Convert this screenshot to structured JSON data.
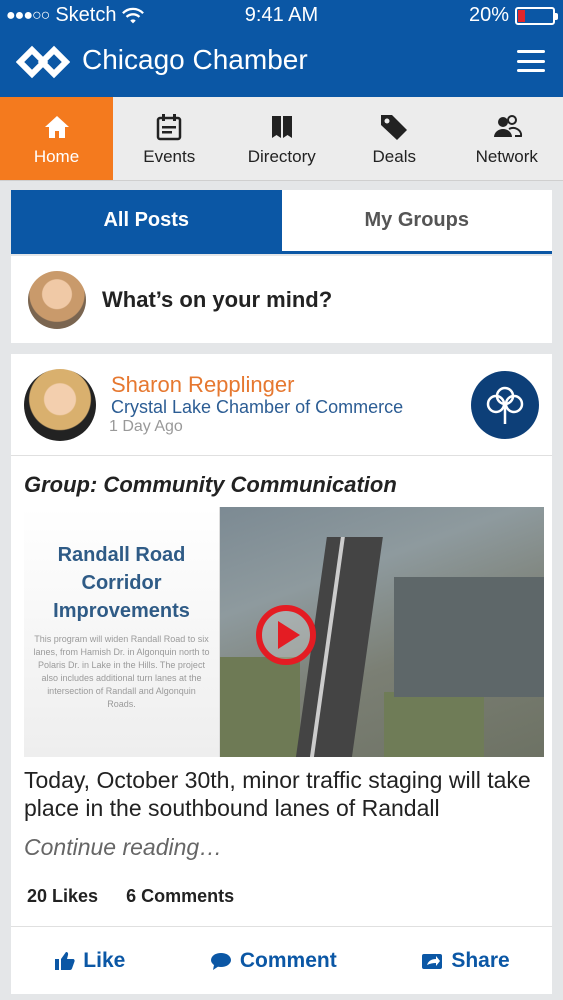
{
  "status_bar": {
    "carrier": "Sketch",
    "time": "9:41 AM",
    "battery": "20%",
    "battery_level": 0.2,
    "battery_color": "#e0262c"
  },
  "app": {
    "title": "Chicago Chamber",
    "brand_color": "#0b57a5",
    "accent_color": "#f47a1e"
  },
  "nav": {
    "items": [
      {
        "label": "Home",
        "icon": "home-icon",
        "active": true
      },
      {
        "label": "Events",
        "icon": "calendar-icon",
        "active": false
      },
      {
        "label": "Directory",
        "icon": "book-icon",
        "active": false
      },
      {
        "label": "Deals",
        "icon": "tag-icon",
        "active": false
      },
      {
        "label": "Network",
        "icon": "people-icon",
        "active": false
      }
    ]
  },
  "tabs": {
    "all_posts": "All Posts",
    "my_groups": "My Groups",
    "active": "All Posts"
  },
  "composer": {
    "prompt": "What’s on your mind?"
  },
  "post": {
    "author": "Sharon Repplinger",
    "organization": "Crystal Lake Chamber of Commerce",
    "time": "1 Day Ago",
    "group": "Group: Community Communication",
    "media": {
      "title_line1": "Randall Road",
      "title_line2": "Corridor",
      "title_line3": "Improvements",
      "description": "This program will widen Randall Road to six lanes, from Hamish Dr. in Algonquin north to Polaris Dr. in Lake in the Hills. The project also includes additional turn lanes at the intersection of Randall and Algonquin Roads."
    },
    "body": "Today, October 30th, minor traffic staging will take place in the southbound lanes of Randall",
    "continue": "Continue reading…",
    "likes": "20 Likes",
    "comments": "6 Comments",
    "actions": {
      "like": "Like",
      "comment": "Comment",
      "share": "Share"
    }
  }
}
